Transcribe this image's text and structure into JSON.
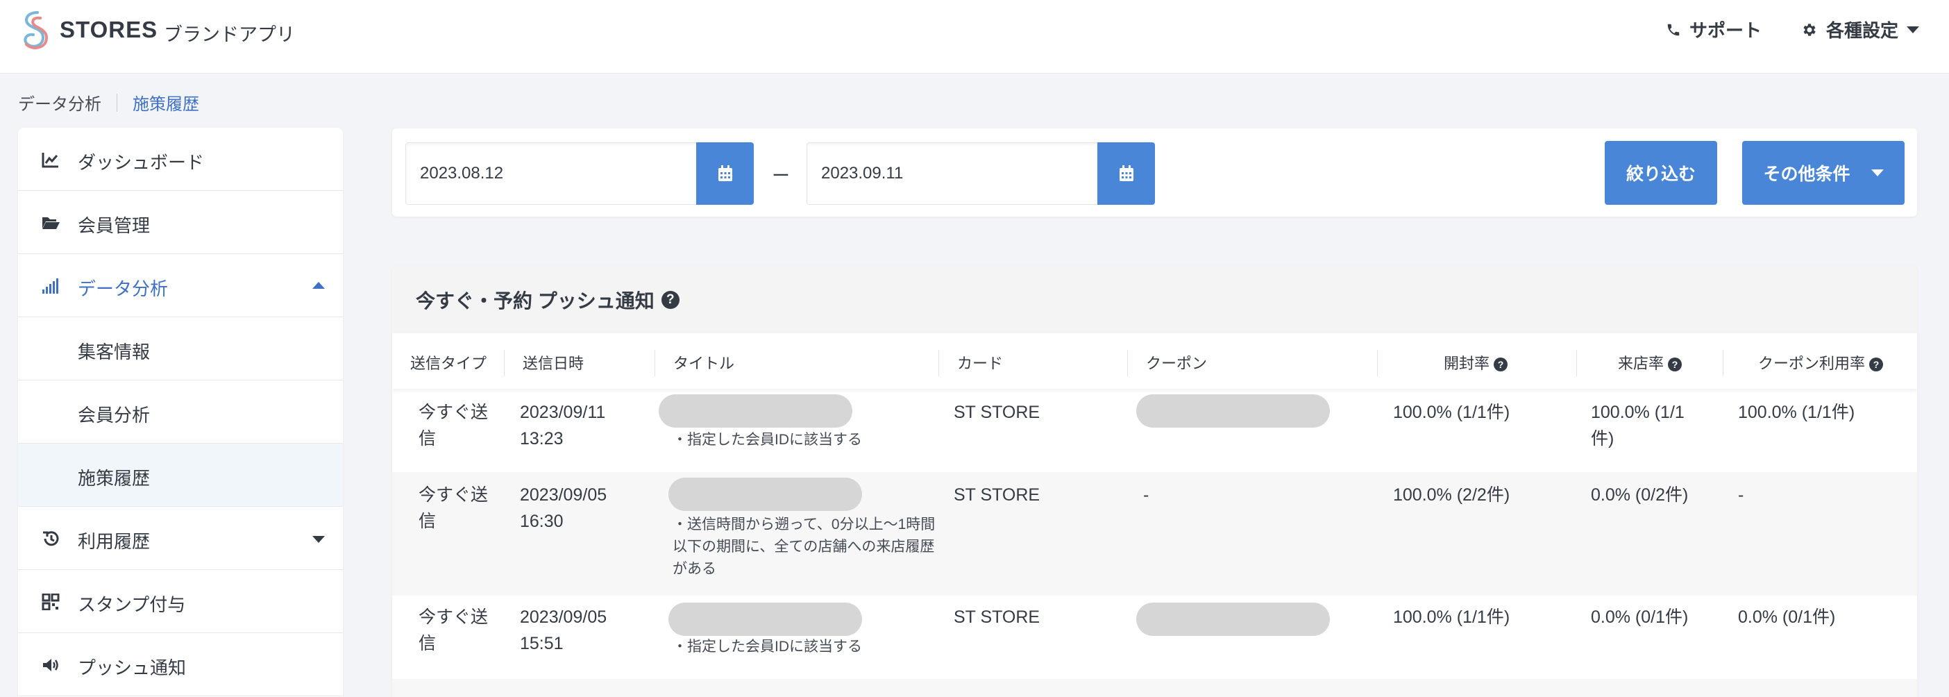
{
  "header": {
    "brand": "STORES",
    "brand_sub": "ブランドアプリ",
    "support": "サポート",
    "settings": "各種設定"
  },
  "breadcrumb": {
    "parent": "データ分析",
    "current": "施策履歴"
  },
  "sidebar": {
    "items": [
      {
        "label": "ダッシュボード",
        "icon": "chart-line-icon"
      },
      {
        "label": "会員管理",
        "icon": "folder-open-icon"
      },
      {
        "label": "データ分析",
        "icon": "signal-bars-icon",
        "active": true,
        "expanded": true
      },
      {
        "label": "集客情報",
        "sub": true
      },
      {
        "label": "会員分析",
        "sub": true
      },
      {
        "label": "施策履歴",
        "sub": true,
        "current": true
      },
      {
        "label": "利用履歴",
        "icon": "history-icon",
        "collapsed": true
      },
      {
        "label": "スタンプ付与",
        "icon": "qr-code-icon"
      },
      {
        "label": "プッシュ通知",
        "icon": "megaphone-icon"
      }
    ]
  },
  "filter": {
    "date_from": "2023.08.12",
    "date_sep": "ー",
    "date_to": "2023.09.11",
    "filter_button": "絞り込む",
    "more_button": "その他条件"
  },
  "table": {
    "title": "今すぐ・予約 プッシュ通知",
    "columns": [
      "送信タイプ",
      "送信日時",
      "タイトル",
      "カード",
      "クーポン",
      "開封率",
      "来店率",
      "クーポン利用率"
    ],
    "rows": [
      {
        "type": "今すぐ送信",
        "date": "2023/09/11",
        "time": "13:23",
        "title_note": "・指定した会員IDに該当する",
        "card": "ST STORE",
        "coupon": "",
        "open_rate": "100.0% (1/1件)",
        "visit_rate": "100.0% (1/1件)",
        "coupon_rate": "100.0% (1/1件)"
      },
      {
        "type": "今すぐ送信",
        "date": "2023/09/05",
        "time": "16:30",
        "title_note": "・送信時間から遡って、0分以上〜1時間以下の期間に、全ての店舗への来店履歴がある",
        "card": "ST STORE",
        "coupon": "-",
        "open_rate": "100.0% (2/2件)",
        "visit_rate": "0.0% (0/2件)",
        "coupon_rate": "-"
      },
      {
        "type": "今すぐ送信",
        "date": "2023/09/05",
        "time": "15:51",
        "title_note": "・指定した会員IDに該当する",
        "card": "ST STORE",
        "coupon": "",
        "open_rate": "100.0% (1/1件)",
        "visit_rate": "0.0% (0/1件)",
        "coupon_rate": "0.0% (0/1件)"
      }
    ]
  },
  "colors": {
    "accent": "#4a86d8",
    "link": "#3f70c4",
    "text": "#353b45",
    "background": "#f3f4f7",
    "redacted": "#d6d6d6"
  }
}
